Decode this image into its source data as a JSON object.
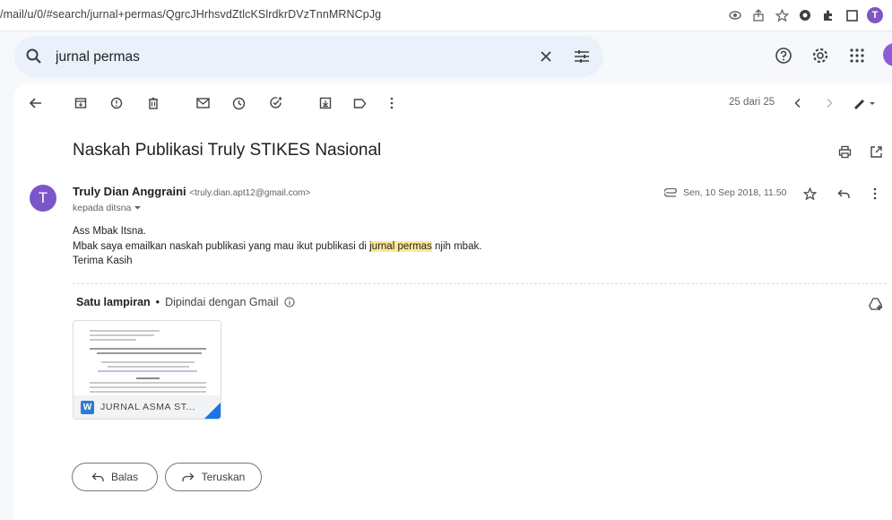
{
  "browser": {
    "url": "/mail/u/0/#search/jurnal+permas/QgrcJHrhsvdZtlcKSlrdkrDVzTnnMRNCpJg",
    "profile_initial": "T"
  },
  "search": {
    "value": "jurnal permas"
  },
  "toolbar": {
    "pager": "25 dari 25"
  },
  "email": {
    "subject": "Naskah Publikasi Truly STIKES Nasional",
    "avatar_initial": "T",
    "sender_name": "Truly Dian Anggraini",
    "sender_email": "<truly.dian.apt12@gmail.com>",
    "recipient": "kepada ditsna",
    "date": "Sen, 10 Sep 2018, 11.50",
    "body": {
      "greeting": "Ass Mbak Itsna.",
      "line2_before": "Mbak saya emailkan naskah publikasi yang mau ikut publikasi di ",
      "line2_highlight": "jurnal permas",
      "line2_after": " njih mbak.",
      "closing": "Terima Kasih"
    }
  },
  "attachments": {
    "header_label": "Satu lampiran",
    "header_separator": "•",
    "header_sub": "Dipindai dengan Gmail",
    "items": [
      {
        "name": "JURNAL ASMA ST...",
        "type_letter": "W"
      }
    ]
  },
  "actions": {
    "reply_label": "Balas",
    "forward_label": "Teruskan"
  },
  "colors": {
    "accent": "#1a73e8",
    "avatar": "#7b56c9",
    "highlight": "#fce895"
  }
}
